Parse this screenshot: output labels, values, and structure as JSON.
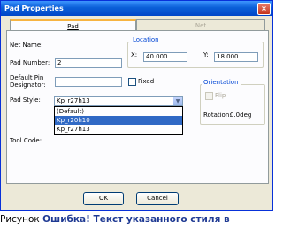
{
  "window": {
    "title": "Pad Properties",
    "close_glyph": "×"
  },
  "tabs": [
    {
      "label": "Pad"
    },
    {
      "label": "Net"
    }
  ],
  "form": {
    "net_name_label": "Net Name:",
    "pad_number_label": "Pad Number:",
    "pad_number_value": "2",
    "default_pin_label_1": "Default Pin",
    "default_pin_label_2": "Designator:",
    "default_pin_value": "",
    "fixed_label": "Fixed",
    "pad_style_label": "Pad Style:",
    "pad_style_value": "Kp_r27h13",
    "tool_code_label": "Tool Code:"
  },
  "location": {
    "title": "Location",
    "x_label": "X:",
    "x_value": "40.000",
    "y_label": "Y:",
    "y_value": "18.000"
  },
  "orientation": {
    "title": "Orientation",
    "flip_label": "Flip",
    "rotation_label": "Rotation:",
    "rotation_value": "0.0deg"
  },
  "dropdown": {
    "options": [
      "(Default)",
      "Kp_r20h10",
      "Kp_r27h13"
    ],
    "selected_index": 1
  },
  "buttons": {
    "ok": "OK",
    "cancel": "Cancel"
  },
  "caption": {
    "prefix": "Рисунок ",
    "error": "Ошибка! Текст указанного стиля в"
  },
  "colors": {
    "titlebar": "#0a5fd8",
    "selection": "#316ac5",
    "group_title": "#0046d5"
  }
}
